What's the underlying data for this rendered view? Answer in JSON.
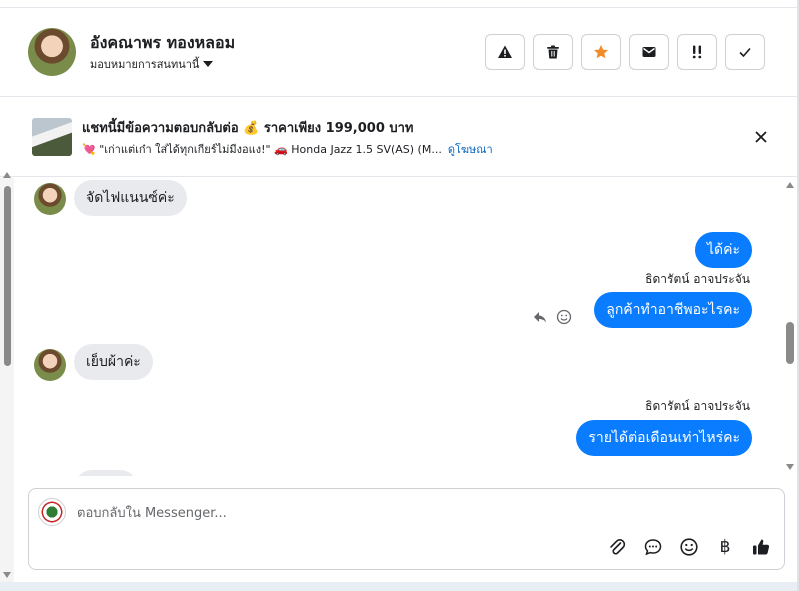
{
  "header": {
    "contact_name": "อังคณาพร ทองหลอม",
    "assign_label": "มอบหมายการสนทนานี้",
    "actions": [
      {
        "name": "report-button",
        "icon": "warning-icon"
      },
      {
        "name": "delete-button",
        "icon": "trash-icon"
      },
      {
        "name": "star-button",
        "icon": "star-icon"
      },
      {
        "name": "mark-unread-button",
        "icon": "envelope-icon"
      },
      {
        "name": "follow-up-button",
        "icon": "double-exclamation-icon"
      },
      {
        "name": "mark-done-button",
        "icon": "checkmark-icon"
      }
    ],
    "star_color": "#f28c28"
  },
  "ad_banner": {
    "title": "แชทนี้มีข้อความตอบกลับต่อ 💰 ราคาเพียง 199,000 บาท",
    "subtitle": "💘 \"เก่าแต่เก๋า ใส่ได้ทุกเกียร์ไม่มีงอแง!\" 🚗 Honda Jazz 1.5 SV(AS) (M...",
    "link_label": "ดูโฆษณา"
  },
  "messages": [
    {
      "direction": "in",
      "text": "จัดไฟแนนซ์ค่ะ"
    },
    {
      "direction": "out",
      "text": "ได้ค่ะ"
    },
    {
      "direction": "out",
      "sender": "ธิดารัตน์ อาจประจัน",
      "text": "ลูกค้าทำอาชีพอะไรคะ"
    },
    {
      "direction": "in",
      "text": "เย็บผ้าค่ะ"
    },
    {
      "direction": "out",
      "sender": "ธิดารัตน์ อาจประจัน",
      "text": "รายได้ต่อเดือนเท่าไหร่คะ"
    }
  ],
  "composer": {
    "placeholder": "ตอบกลับใน Messenger...",
    "tools": [
      "paperclip-icon",
      "chat-bubble-icon",
      "smiley-icon",
      "baht-icon",
      "thumbs-up-icon"
    ],
    "baht_symbol": "฿"
  },
  "colors": {
    "outgoing_bubble": "#0a7cff",
    "incoming_bubble": "#e9eaed",
    "link": "#0a66c2"
  }
}
